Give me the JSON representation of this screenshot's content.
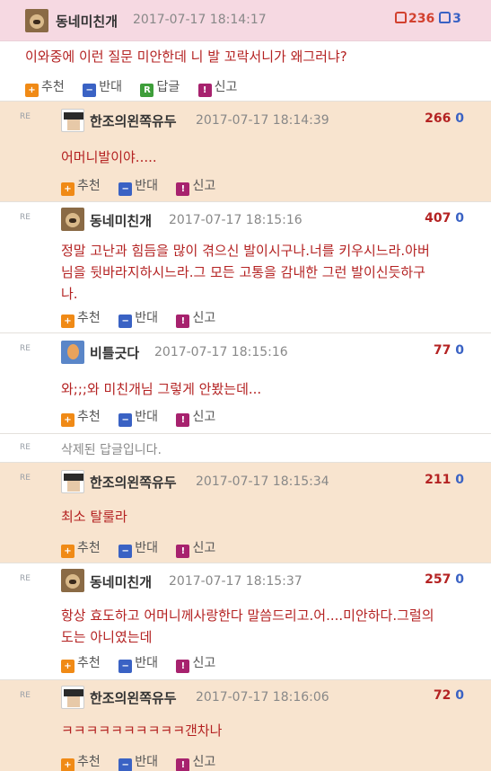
{
  "post": {
    "nickname": "동네미친개",
    "date": "2017-07-17 18:14:17",
    "upvotes": "236",
    "downvotes": "3",
    "text": "이와중에 이런 질문 미안한데 니 발 꼬락서니가 왜그러냐?",
    "actions": {
      "recommend": "추천",
      "oppose": "반대",
      "reply": "답글",
      "report": "신고"
    }
  },
  "re_tag": "RE",
  "replies": [
    {
      "nickname": "한조의왼쪽유두",
      "date": "2017-07-17 18:14:39",
      "up": "266",
      "down": "0",
      "lines": [
        "어머니발이야....."
      ],
      "actions": {
        "recommend": "추천",
        "oppose": "반대",
        "report": "신고"
      }
    },
    {
      "nickname": "동네미친개",
      "date": "2017-07-17 18:15:16",
      "up": "407",
      "down": "0",
      "lines": [
        "정말 고난과 힘듬을 많이 겪으신 발이시구나.너를 키우시느라.아버",
        "님을 뒷바라지하시느라.그 모든 고통을 감내한 그런 발이신듯하구",
        "나."
      ],
      "actions": {
        "recommend": "추천",
        "oppose": "반대",
        "report": "신고"
      }
    },
    {
      "nickname": "비틀긋다",
      "date": "2017-07-17 18:15:16",
      "up": "77",
      "down": "0",
      "lines": [
        "와;;;와 미친개님 그렇게 안봤는데..."
      ],
      "actions": {
        "recommend": "추천",
        "oppose": "반대",
        "report": "신고"
      }
    },
    {
      "deleted_text": "삭제된 답글입니다."
    },
    {
      "nickname": "한조의왼쪽유두",
      "date": "2017-07-17 18:15:34",
      "up": "211",
      "down": "0",
      "lines": [
        "최소 탈룰라"
      ],
      "actions": {
        "recommend": "추천",
        "oppose": "반대",
        "report": "신고"
      }
    },
    {
      "nickname": "동네미친개",
      "date": "2017-07-17 18:15:37",
      "up": "257",
      "down": "0",
      "lines": [
        "항상 효도하고 어머니께사랑한다 말씀드리고.어....미안하다.그럴의",
        "도는 아니였는데"
      ],
      "actions": {
        "recommend": "추천",
        "oppose": "반대",
        "report": "신고"
      }
    },
    {
      "nickname": "한조의왼쪽유두",
      "date": "2017-07-17 18:16:06",
      "up": "72",
      "down": "0",
      "lines": [
        "ㅋㅋㅋㅋㅋㅋㅋㅋㅋㅋ갠차나"
      ],
      "actions": {
        "recommend": "추천",
        "oppose": "반대",
        "report": "신고"
      }
    }
  ]
}
